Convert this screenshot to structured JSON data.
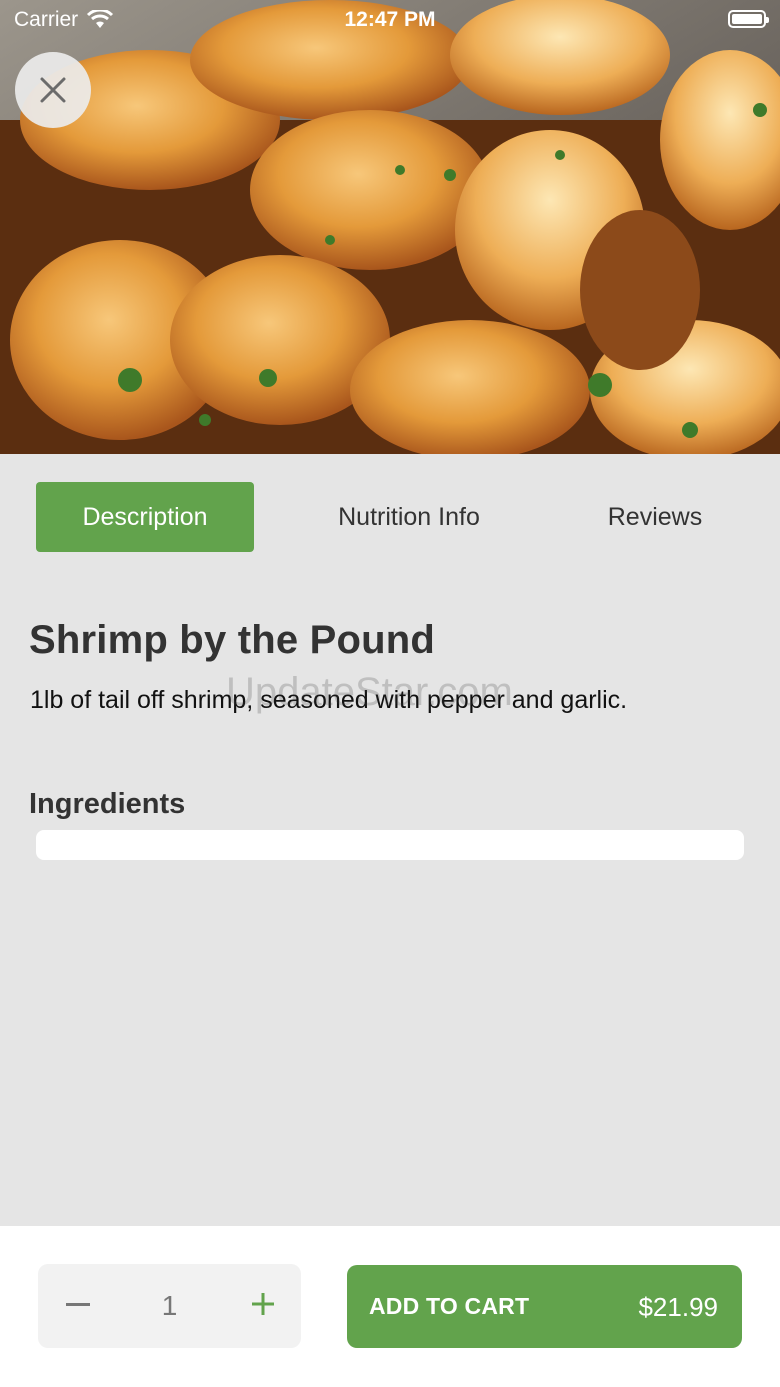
{
  "status_bar": {
    "carrier": "Carrier",
    "time": "12:47 PM"
  },
  "tabs": [
    {
      "label": "Description",
      "active": true
    },
    {
      "label": "Nutrition Info",
      "active": false
    },
    {
      "label": "Reviews",
      "active": false
    }
  ],
  "product": {
    "title": "Shrimp by the Pound",
    "description": "1lb of tail off shrimp, seasoned with pepper and garlic."
  },
  "watermark": "UpdateStar.com",
  "ingredients": {
    "heading": "Ingredients"
  },
  "cart": {
    "quantity": "1",
    "add_label": "ADD TO CART",
    "price": "$21.99"
  },
  "colors": {
    "accent": "#62a34c",
    "background": "#e5e5e5"
  },
  "icons": {
    "close": "close-icon",
    "wifi": "wifi-icon",
    "battery": "battery-icon",
    "minus": "minus-icon",
    "plus": "plus-icon"
  }
}
